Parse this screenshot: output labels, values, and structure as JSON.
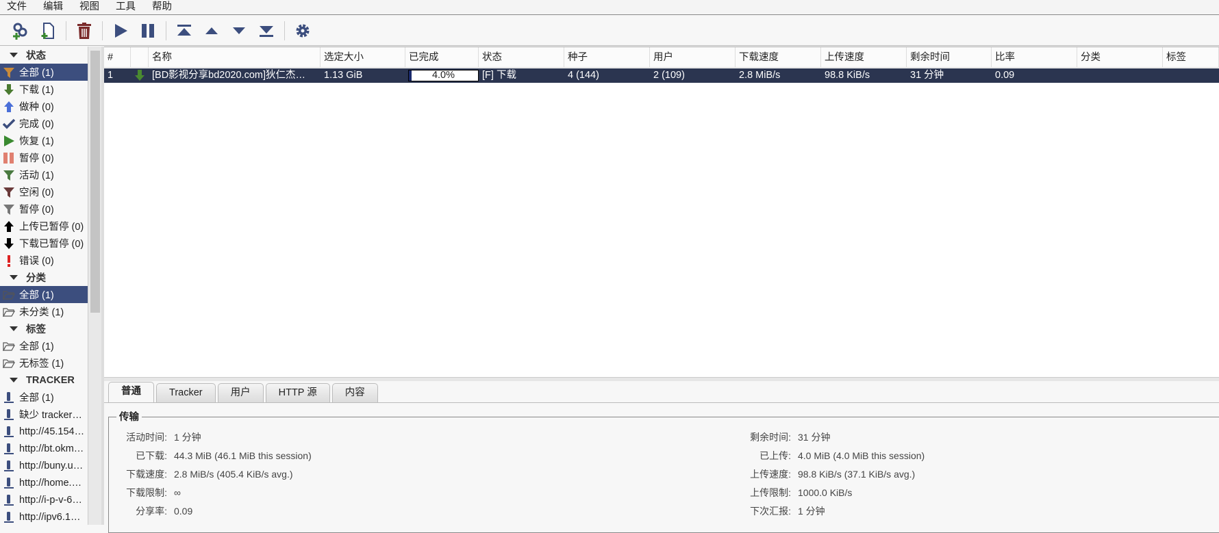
{
  "menu": [
    "文件",
    "编辑",
    "视图",
    "工具",
    "帮助"
  ],
  "toolbar": [
    "add-link",
    "add-file",
    "delete",
    "resume",
    "pause",
    "top-priority",
    "increase-priority",
    "decrease-priority",
    "bottom-priority",
    "options"
  ],
  "sidebar": {
    "status_title": "状态",
    "status": [
      {
        "label": "全部 (1)",
        "icon": "filter-icon",
        "color": "#c98a3a"
      },
      {
        "label": "下载 (1)",
        "icon": "arrow-down-icon",
        "color": "#4a7a30"
      },
      {
        "label": "做种 (0)",
        "icon": "arrow-up-icon",
        "color": "#4a6fd8"
      },
      {
        "label": "完成 (0)",
        "icon": "check-icon",
        "color": "#3c4e7e"
      },
      {
        "label": "恢复 (1)",
        "icon": "play-icon",
        "color": "#3a8a30"
      },
      {
        "label": "暂停 (0)",
        "icon": "pause-icon",
        "color": "#e08070"
      },
      {
        "label": "活动 (1)",
        "icon": "filter-icon",
        "color": "#4a7a40"
      },
      {
        "label": "空闲 (0)",
        "icon": "filter-icon",
        "color": "#6a3a3a"
      },
      {
        "label": "暂停 (0)",
        "icon": "filter-icon",
        "color": "#777777"
      },
      {
        "label": "上传已暂停 (0)",
        "icon": "arrow-up-icon",
        "color": "#000000"
      },
      {
        "label": "下载已暂停 (0)",
        "icon": "arrow-down-icon",
        "color": "#000000"
      },
      {
        "label": "错误 (0)",
        "icon": "exclamation-icon",
        "color": "#dd2222"
      }
    ],
    "category_title": "分类",
    "categories": [
      "全部 (1)",
      "未分类 (1)"
    ],
    "tags_title": "标签",
    "tags": [
      "全部 (1)",
      "无标签 (1)"
    ],
    "tracker_title": "TRACKER",
    "trackers": [
      "全部 (1)",
      "缺少 tracker…",
      "http://45.154…",
      "http://bt.okm…",
      "http://buny.u…",
      "http://home.…",
      "http://i-p-v-6…",
      "http://ipv6.1…"
    ]
  },
  "table": {
    "headers": [
      "#",
      "",
      "名称",
      "选定大小",
      "已完成",
      "状态",
      "种子",
      "用户",
      "下载速度",
      "上传速度",
      "剩余时间",
      "比率",
      "分类",
      "标签"
    ],
    "rows": [
      {
        "num": "1",
        "name": "[BD影视分享bd2020.com]狄仁杰…",
        "size": "1.13 GiB",
        "progress": "4.0%",
        "progress_value": 4.0,
        "status": "[F] 下载",
        "seeds": "4 (144)",
        "peers": "2 (109)",
        "dl": "2.8 MiB/s",
        "ul": "98.8 KiB/s",
        "eta": "31 分钟",
        "ratio": "0.09",
        "category": "",
        "tags": ""
      }
    ]
  },
  "tabs": [
    "普通",
    "Tracker",
    "用户",
    "HTTP 源",
    "内容"
  ],
  "transfer": {
    "title": "传输",
    "left": [
      {
        "k": "活动时间:",
        "v": "1 分钟"
      },
      {
        "k": "已下载:",
        "v": "44.3 MiB (46.1 MiB this session)"
      },
      {
        "k": "下载速度:",
        "v": "2.8 MiB/s (405.4 KiB/s avg.)"
      },
      {
        "k": "下载限制:",
        "v": "∞"
      },
      {
        "k": "分享率:",
        "v": "0.09"
      }
    ],
    "right": [
      {
        "k": "剩余时间:",
        "v": "31 分钟"
      },
      {
        "k": "已上传:",
        "v": "4.0 MiB (4.0 MiB this session)"
      },
      {
        "k": "上传速度:",
        "v": "98.8 KiB/s (37.1 KiB/s avg.)"
      },
      {
        "k": "上传限制:",
        "v": "1000.0 KiB/s"
      },
      {
        "k": "下次汇报:",
        "v": "1 分钟"
      }
    ]
  }
}
